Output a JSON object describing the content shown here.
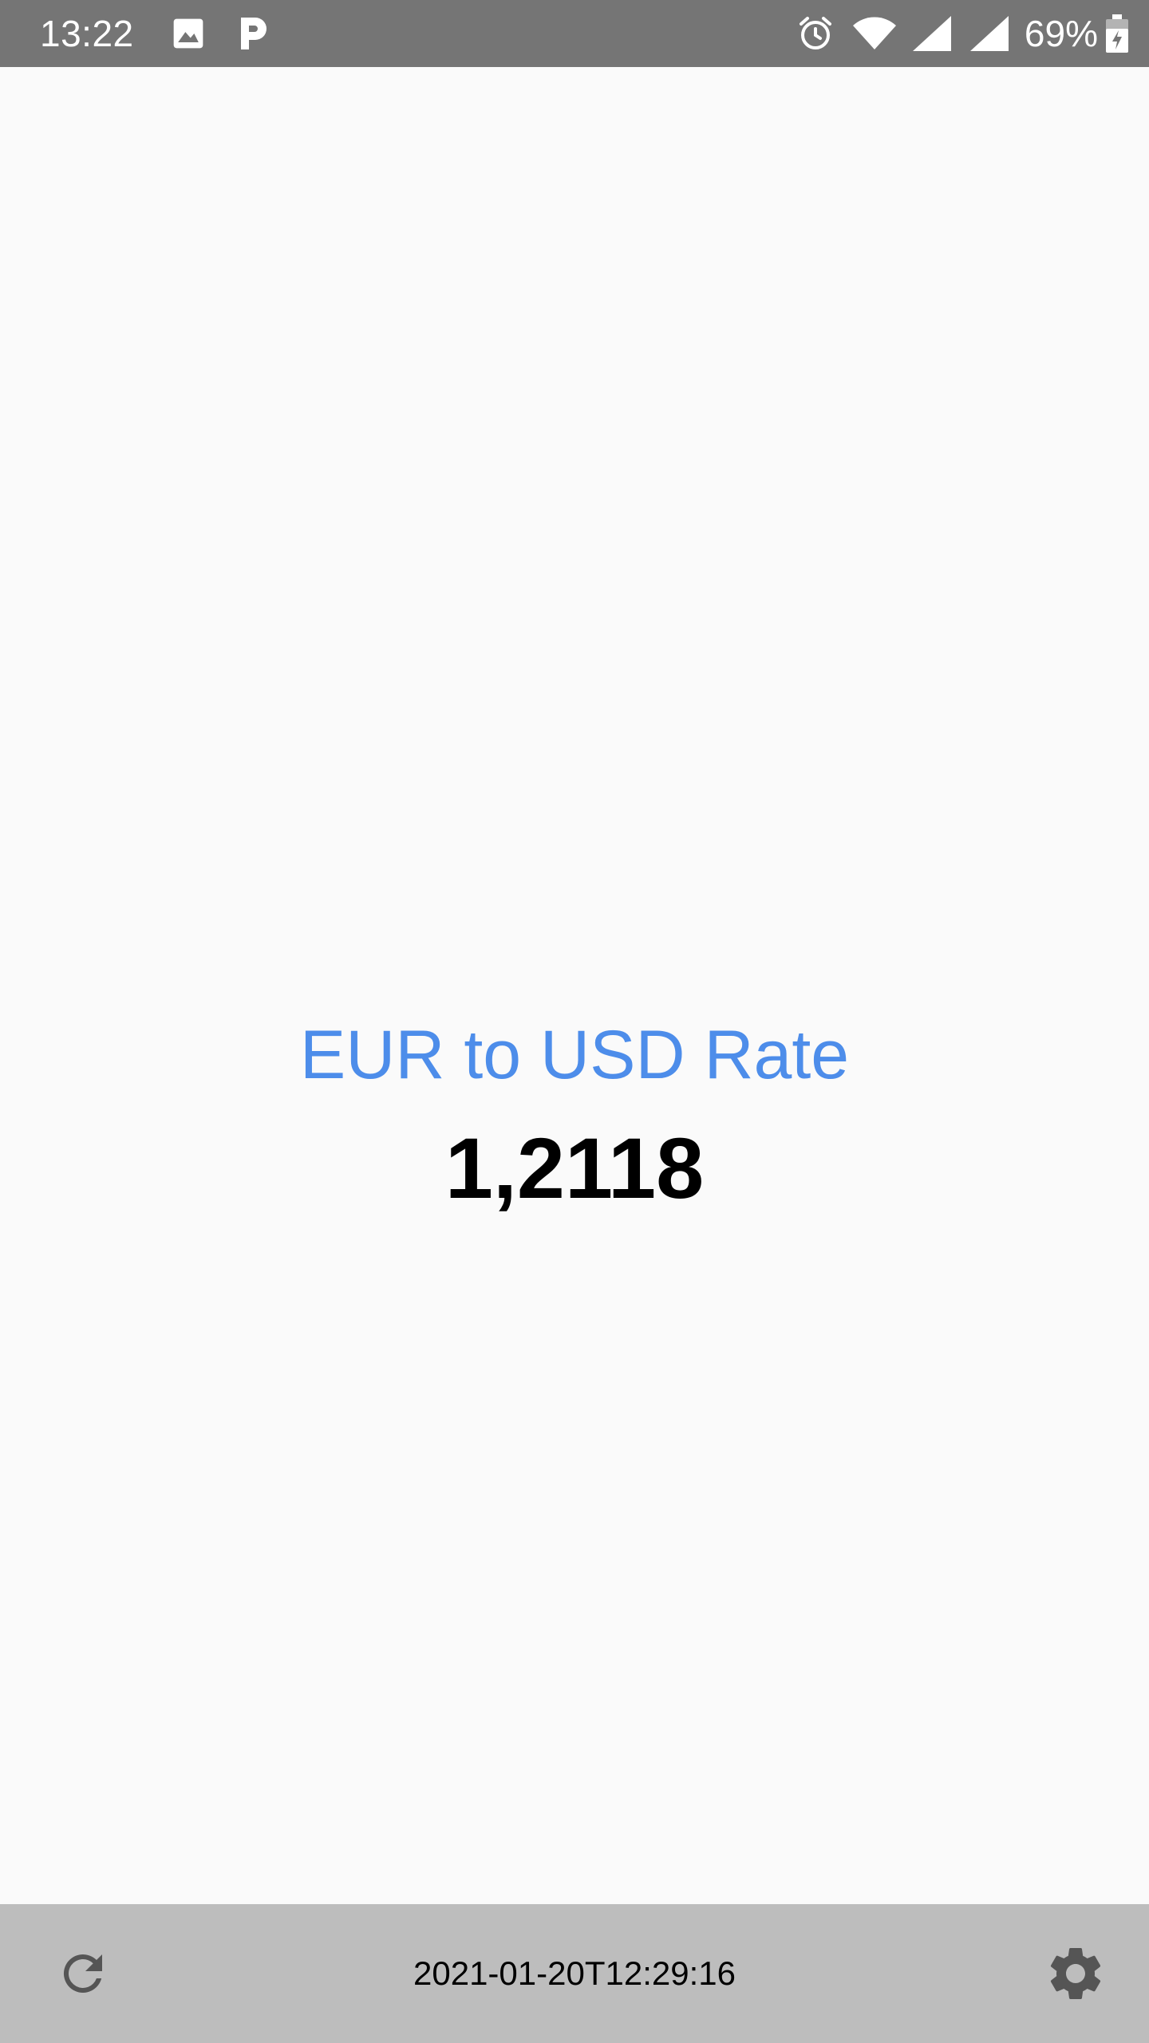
{
  "status_bar": {
    "time": "13:22",
    "battery": "69%",
    "icons": [
      "image-icon",
      "p-app-icon",
      "alarm-icon",
      "wifi-icon",
      "signal-icon",
      "signal-icon",
      "battery-charging-icon"
    ]
  },
  "main": {
    "label": "EUR to USD Rate",
    "value": "1,2118"
  },
  "bottom_bar": {
    "timestamp": "2021-01-20T12:29:16",
    "left_icon": "refresh-icon",
    "right_icon": "gear-icon"
  },
  "colors": {
    "status_bar": "#757575",
    "background": "#FAFAFA",
    "accent": "#4D8DEA",
    "bottom_bar": "#BDBDBD",
    "icon": "#555555"
  }
}
